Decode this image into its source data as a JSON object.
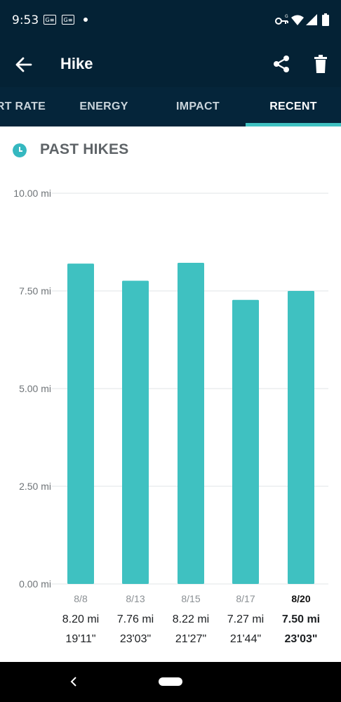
{
  "status_bar": {
    "time": "9:53",
    "notif_icons": [
      "G≡",
      "G≡"
    ]
  },
  "app_bar": {
    "title": "Hike",
    "back_icon": "arrow-left-icon",
    "share_icon": "share-icon",
    "delete_icon": "trash-icon"
  },
  "tabs": [
    {
      "label": "RT RATE",
      "active": false
    },
    {
      "label": "ENERGY",
      "active": false
    },
    {
      "label": "IMPACT",
      "active": false
    },
    {
      "label": "RECENT",
      "active": true
    }
  ],
  "section": {
    "title": "PAST HIKES",
    "icon": "clock-icon"
  },
  "colors": {
    "header_bg": "#042235",
    "accent": "#3fc1c1",
    "bar": "#3fc1c1"
  },
  "chart_data": {
    "type": "bar",
    "categories": [
      "8/8",
      "8/13",
      "8/15",
      "8/17",
      "8/20"
    ],
    "values": [
      8.2,
      7.76,
      8.22,
      7.27,
      7.5
    ],
    "distance_labels": [
      "8.20 mi",
      "7.76 mi",
      "8.22 mi",
      "7.27 mi",
      "7.50 mi"
    ],
    "duration_labels": [
      "19'11\"",
      "23'03\"",
      "21'27\"",
      "21'44\"",
      "23'03\""
    ],
    "selected_index": 4,
    "ylim": [
      0,
      10
    ],
    "yticks": [
      0,
      2.5,
      5,
      7.5,
      10
    ],
    "ytick_labels": [
      "0.00 mi",
      "2.50 mi",
      "5.00 mi",
      "7.50 mi",
      "10.00 mi"
    ],
    "grid": true
  }
}
